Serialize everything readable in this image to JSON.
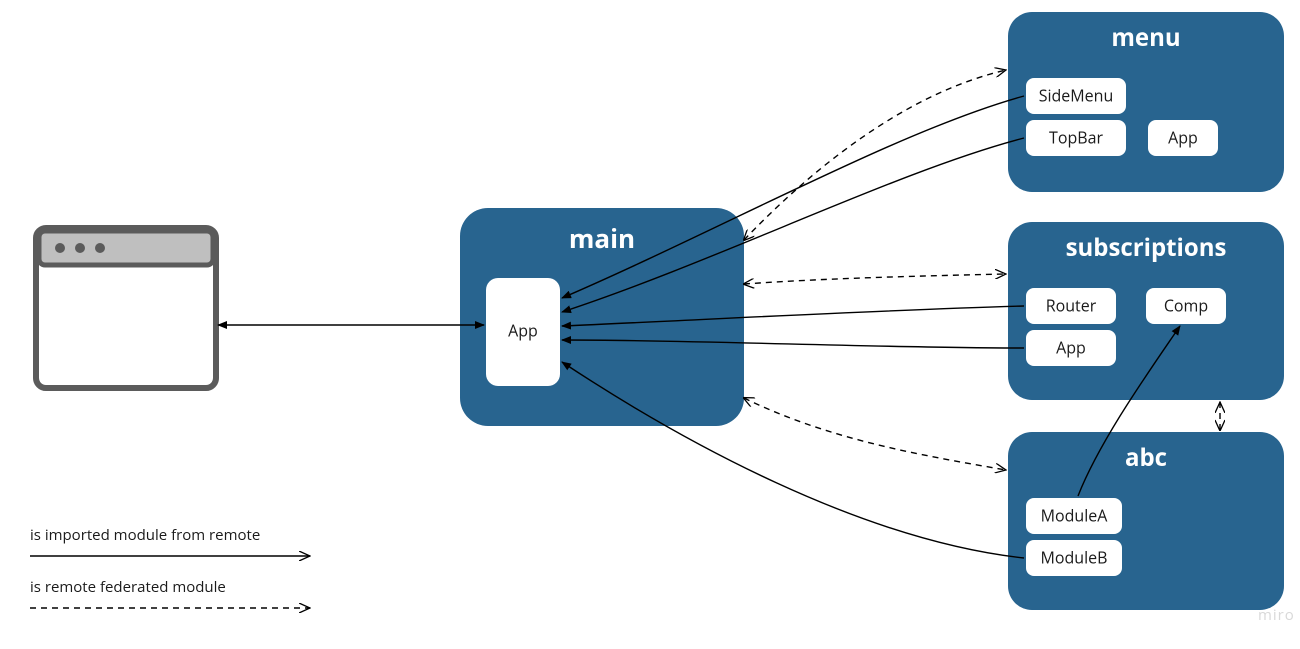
{
  "modules": {
    "main": {
      "title": "main",
      "chips": {
        "app": "App"
      }
    },
    "menu": {
      "title": "menu",
      "chips": {
        "sidemenu": "SideMenu",
        "topbar": "TopBar",
        "app": "App"
      }
    },
    "subscriptions": {
      "title": "subscriptions",
      "chips": {
        "router": "Router",
        "app": "App",
        "comp": "Comp"
      }
    },
    "abc": {
      "title": "abc",
      "chips": {
        "modulea": "ModuleA",
        "moduleb": "ModuleB"
      }
    }
  },
  "legend": {
    "imported": "is imported module from remote",
    "federated": "is remote federated module"
  },
  "watermark": "miro"
}
